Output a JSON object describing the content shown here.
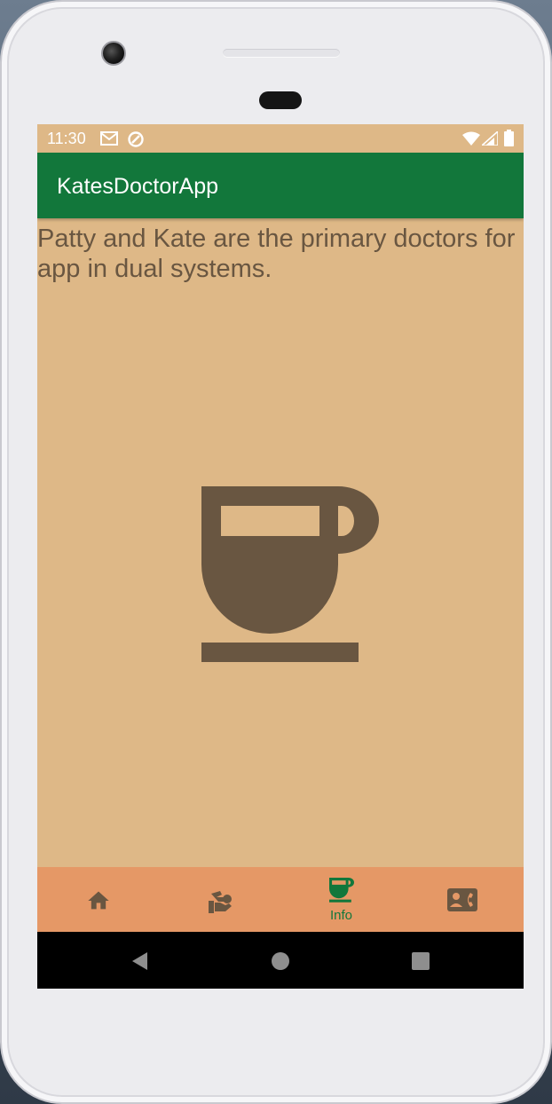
{
  "status_bar": {
    "time": "11:30",
    "left_icons": [
      "gmail-icon",
      "sync-icon"
    ],
    "right_icons": [
      "wifi-icon",
      "signal-icon",
      "battery-icon"
    ]
  },
  "app_bar": {
    "title": "KatesDoctorApp"
  },
  "content": {
    "text": "Patty and Kate are the primary doctors for app in dual systems.",
    "hero_icon": "coffee-cup-icon"
  },
  "bottom_nav": {
    "items": [
      {
        "icon": "home-icon",
        "label": "",
        "active": false
      },
      {
        "icon": "hand-care-icon",
        "label": "",
        "active": false
      },
      {
        "icon": "coffee-cup-icon",
        "label": "Info",
        "active": true
      },
      {
        "icon": "contact-phone-icon",
        "label": "",
        "active": false
      }
    ]
  },
  "system_nav": {
    "buttons": [
      "back-icon",
      "home-circle-icon",
      "recents-icon"
    ]
  },
  "colors": {
    "background": "#deb887",
    "app_bar": "#12773b",
    "bottom_nav": "#e59866",
    "icon": "#695641",
    "active": "#12773b"
  }
}
